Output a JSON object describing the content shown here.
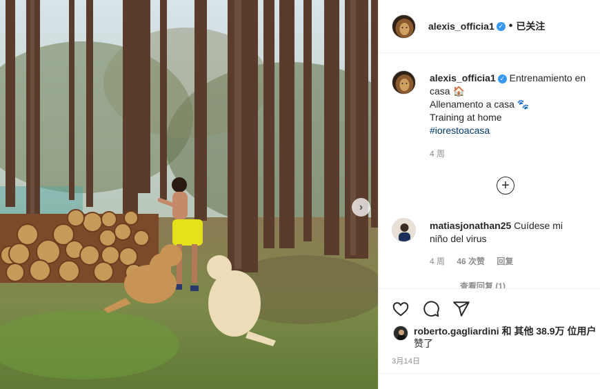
{
  "post": {
    "author": "alexis_officia1",
    "follow_status": "已关注",
    "dot": "•",
    "caption_text": "Entrenamiento en casa 🏠",
    "caption_line2": "Allenamento a casa 🐾",
    "caption_line3": "Training at home",
    "hashtag": "#iorestoacasa",
    "caption_age": "4 周",
    "verified_mark": "✓"
  },
  "comment": {
    "author": "matiasjonathan25",
    "text": "Cuídese mi niño del virus",
    "age": "4 周",
    "likes": "46 次赞",
    "reply": "回复",
    "view_replies": "查看回复 (1)"
  },
  "likes": {
    "line1": "roberto.gagliardini 和 其他 38.9万 位用户",
    "line2": "赞了"
  },
  "date": "3月14日",
  "load_more_symbol": "+",
  "carousel_next": "›",
  "icons": [
    "heart-icon",
    "comment-icon",
    "share-icon",
    "plus-circle-icon",
    "chevron-right-icon",
    "verified-icon"
  ],
  "colors": {
    "link": "#00376b",
    "verified": "#3897f0",
    "muted": "#8e8e8e",
    "text": "#262626"
  }
}
